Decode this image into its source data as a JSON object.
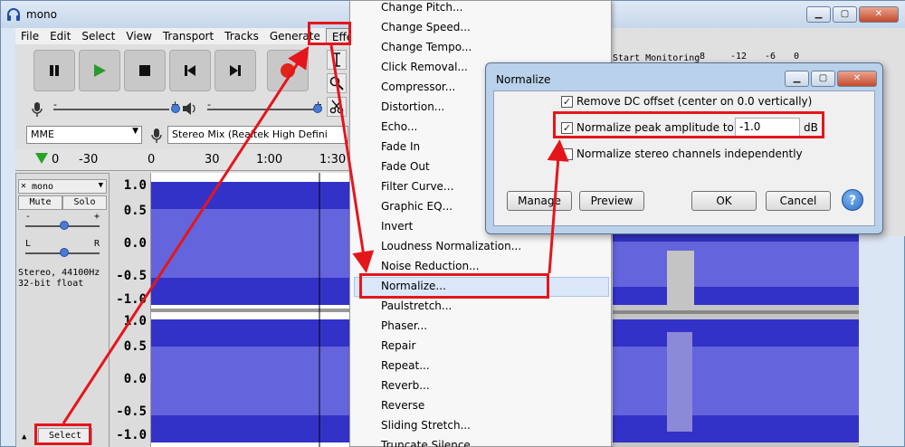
{
  "window": {
    "title": "mono",
    "buttons": {
      "minimize": "▁",
      "maximize": "▢",
      "close": "✕"
    }
  },
  "menubar": {
    "items": [
      "File",
      "Edit",
      "Select",
      "View",
      "Transport",
      "Tracks",
      "Generate",
      "Effect"
    ]
  },
  "toolbar": {
    "host": "MME",
    "recording_device": "Stereo Mix (Realtek High Defini",
    "monitoring_label": "Start Monitoring",
    "meter_ticks": [
      "-8",
      "-12",
      "-6",
      "0"
    ]
  },
  "timeline": {
    "labels": [
      "0",
      "-30",
      "0",
      "30",
      "1:00",
      "1:30"
    ]
  },
  "track": {
    "name": "mono",
    "mute": "Mute",
    "solo": "Solo",
    "gain_minus": "-",
    "gain_plus": "+",
    "pan_left": "L",
    "pan_right": "R",
    "info_line1": "Stereo, 44100Hz",
    "info_line2": "32-bit float",
    "select": "Select",
    "scale": [
      "1.0",
      "0.5",
      "0.0",
      "-0.5",
      "-1.0",
      "1.0",
      "0.5",
      "0.0",
      "-0.5",
      "-1.0"
    ]
  },
  "effect_menu": {
    "items": [
      "Change Pitch...",
      "Change Speed...",
      "Change Tempo...",
      "Click Removal...",
      "Compressor...",
      "Distortion...",
      "Echo...",
      "Fade In",
      "Fade Out",
      "Filter Curve...",
      "Graphic EQ...",
      "Invert",
      "Loudness Normalization...",
      "Noise Reduction...",
      "Normalize...",
      "Paulstretch...",
      "Phaser...",
      "Repair",
      "Repeat...",
      "Reverb...",
      "Reverse",
      "Sliding Stretch...",
      "Truncate Silence..."
    ],
    "highlighted_index": 14
  },
  "normalize_dialog": {
    "title": "Normalize",
    "remove_dc": {
      "label": "Remove DC offset (center on 0.0 vertically)",
      "checked": true
    },
    "normalize_peak": {
      "label": "Normalize peak amplitude to",
      "checked": true,
      "value": "-1.0",
      "unit": "dB"
    },
    "independent": {
      "label": "Normalize stereo channels independently",
      "checked": false
    },
    "buttons": {
      "manage": "Manage",
      "preview": "Preview",
      "ok": "OK",
      "cancel": "Cancel",
      "help": "?"
    }
  },
  "colors": {
    "annotation": "#e4161b",
    "waveform": "#3232c8",
    "waveform_rms": "#6464dc",
    "menu_highlight": "#dbe8fa"
  }
}
